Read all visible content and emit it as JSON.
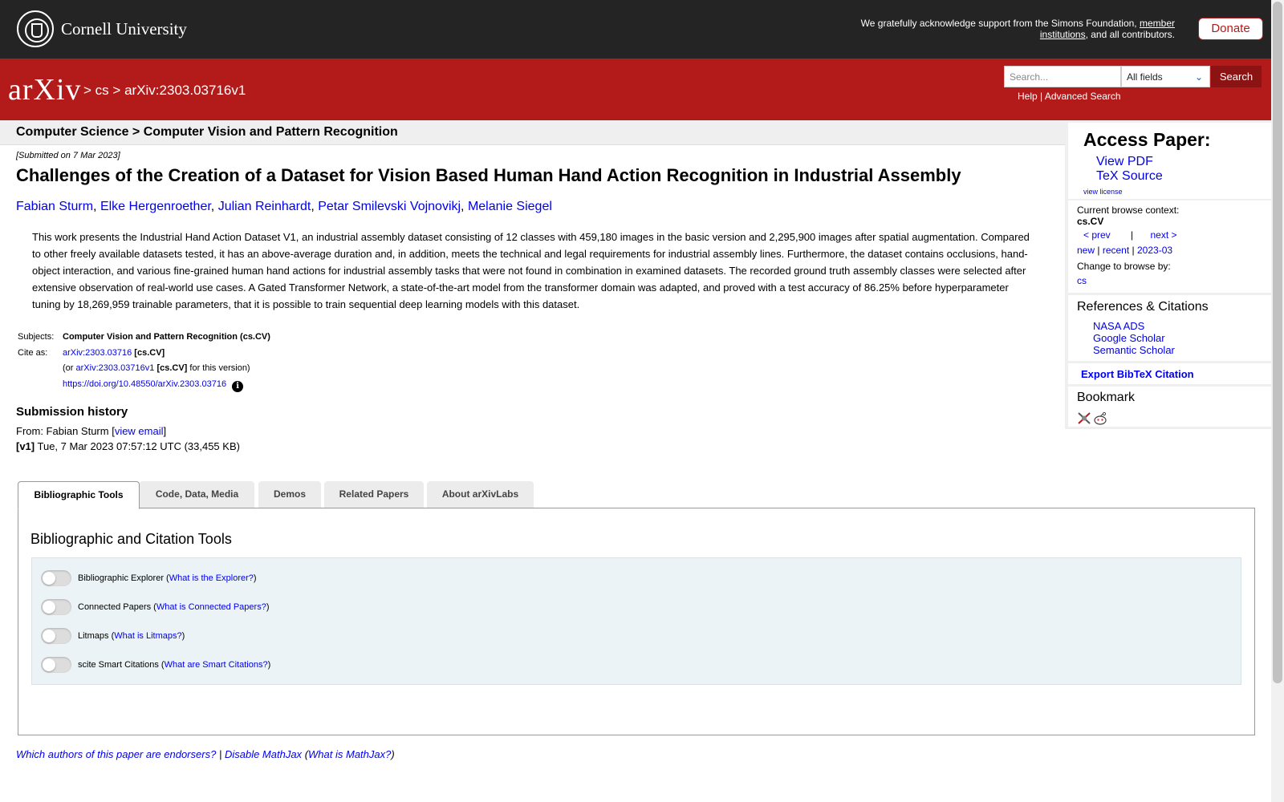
{
  "header": {
    "institution": "Cornell University",
    "ack_text": "We gratefully acknowledge support from the Simons Foundation,",
    "ack_link": "member institutions",
    "ack_tail": ", and all contributors.",
    "donate_label": "Donate"
  },
  "nav": {
    "logo_text": "arXiv",
    "sep1": ">",
    "crumb_cs": "cs",
    "sep2": ">",
    "crumb_id": "arXiv:2303.03716v1",
    "search_placeholder": "Search...",
    "search_field": "All fields",
    "search_button": "Search",
    "help": "Help",
    "pipe": "|",
    "advanced": "Advanced Search"
  },
  "main": {
    "subject_heading": "Computer Science > Computer Vision and Pattern Recognition",
    "submitted": "[Submitted on 7 Mar 2023]",
    "title": "Challenges of the Creation of a Dataset for Vision Based Human Hand Action Recognition in Industrial Assembly",
    "authors": [
      "Fabian Sturm",
      "Elke Hergenroether",
      "Julian Reinhardt",
      "Petar Smilevski Vojnovikj",
      "Melanie Siegel"
    ],
    "abstract": "This work presents the Industrial Hand Action Dataset V1, an industrial assembly dataset consisting of 12 classes with 459,180 images in the basic version and 2,295,900 images after spatial augmentation. Compared to other freely available datasets tested, it has an above-average duration and, in addition, meets the technical and legal requirements for industrial assembly lines. Furthermore, the dataset contains occlusions, hand-object interaction, and various fine-grained human hand actions for industrial assembly tasks that were not found in combination in examined datasets. The recorded ground truth assembly classes were selected after extensive observation of real-world use cases. A Gated Transformer Network, a state-of-the-art model from the transformer domain was adapted, and proved with a test accuracy of 86.25% before hyperparameter tuning by 18,269,959 trainable parameters, that it is possible to train sequential deep learning models with this dataset.",
    "subjects_label": "Subjects:",
    "subjects_value": "Computer Vision and Pattern Recognition (cs.CV)",
    "cite_label": "Cite as:",
    "cite_id": "arXiv:2303.03716",
    "cite_cat": "[cs.CV]",
    "cite_or": "(or",
    "cite_version": "arXiv:2303.03716v1",
    "cite_version_cat": "[cs.CV]",
    "cite_version_tail": "for this version)",
    "doi": "https://doi.org/10.48550/arXiv.2303.03716",
    "info_icon": "i",
    "history_title": "Submission history",
    "from_label": "From: Fabian Sturm [",
    "view_email": "view email",
    "from_close": "]",
    "v1_label": "[v1]",
    "v1_text": "Tue, 7 Mar 2023 07:57:12 UTC (33,455 KB)"
  },
  "sidebar": {
    "access_title": "Access Paper:",
    "view_pdf": "View PDF",
    "tex_source": "TeX Source",
    "view_license": "view license",
    "browse_context_label": "Current browse context:",
    "browse_context": "cs.CV",
    "prev": "< prev",
    "pipe": "|",
    "next": "next >",
    "new": "new",
    "recent": "recent",
    "month": "2023-03",
    "change_browse": "Change to browse by:",
    "browse_cs": "cs",
    "refs_title": "References & Citations",
    "nasa": "NASA ADS",
    "google": "Google Scholar",
    "semantic": "Semantic Scholar",
    "export": "Export BibTeX Citation",
    "bookmark": "Bookmark"
  },
  "tabs": {
    "items": [
      "Bibliographic Tools",
      "Code, Data, Media",
      "Demos",
      "Related Papers",
      "About arXivLabs"
    ],
    "panel_title": "Bibliographic and Citation Tools",
    "tools": [
      {
        "label": "Bibliographic Explorer (",
        "link": "What is the Explorer?",
        "close": ")"
      },
      {
        "label": "Connected Papers (",
        "link": "What is Connected Papers?",
        "close": ")"
      },
      {
        "label": "Litmaps (",
        "link": "What is Litmaps?",
        "close": ")"
      },
      {
        "label": "scite Smart Citations (",
        "link": "What are Smart Citations?",
        "close": ")"
      }
    ]
  },
  "footer": {
    "endorsers": "Which authors of this paper are endorsers?",
    "pipe": "|",
    "disable_mathjax": "Disable MathJax",
    "open_paren": "(",
    "what_mathjax": "What is MathJax?",
    "close_paren": ")"
  },
  "colors": {
    "arxiv_red": "#b31b1b",
    "top_bar": "#242424",
    "link_blue": "#0000ee"
  }
}
